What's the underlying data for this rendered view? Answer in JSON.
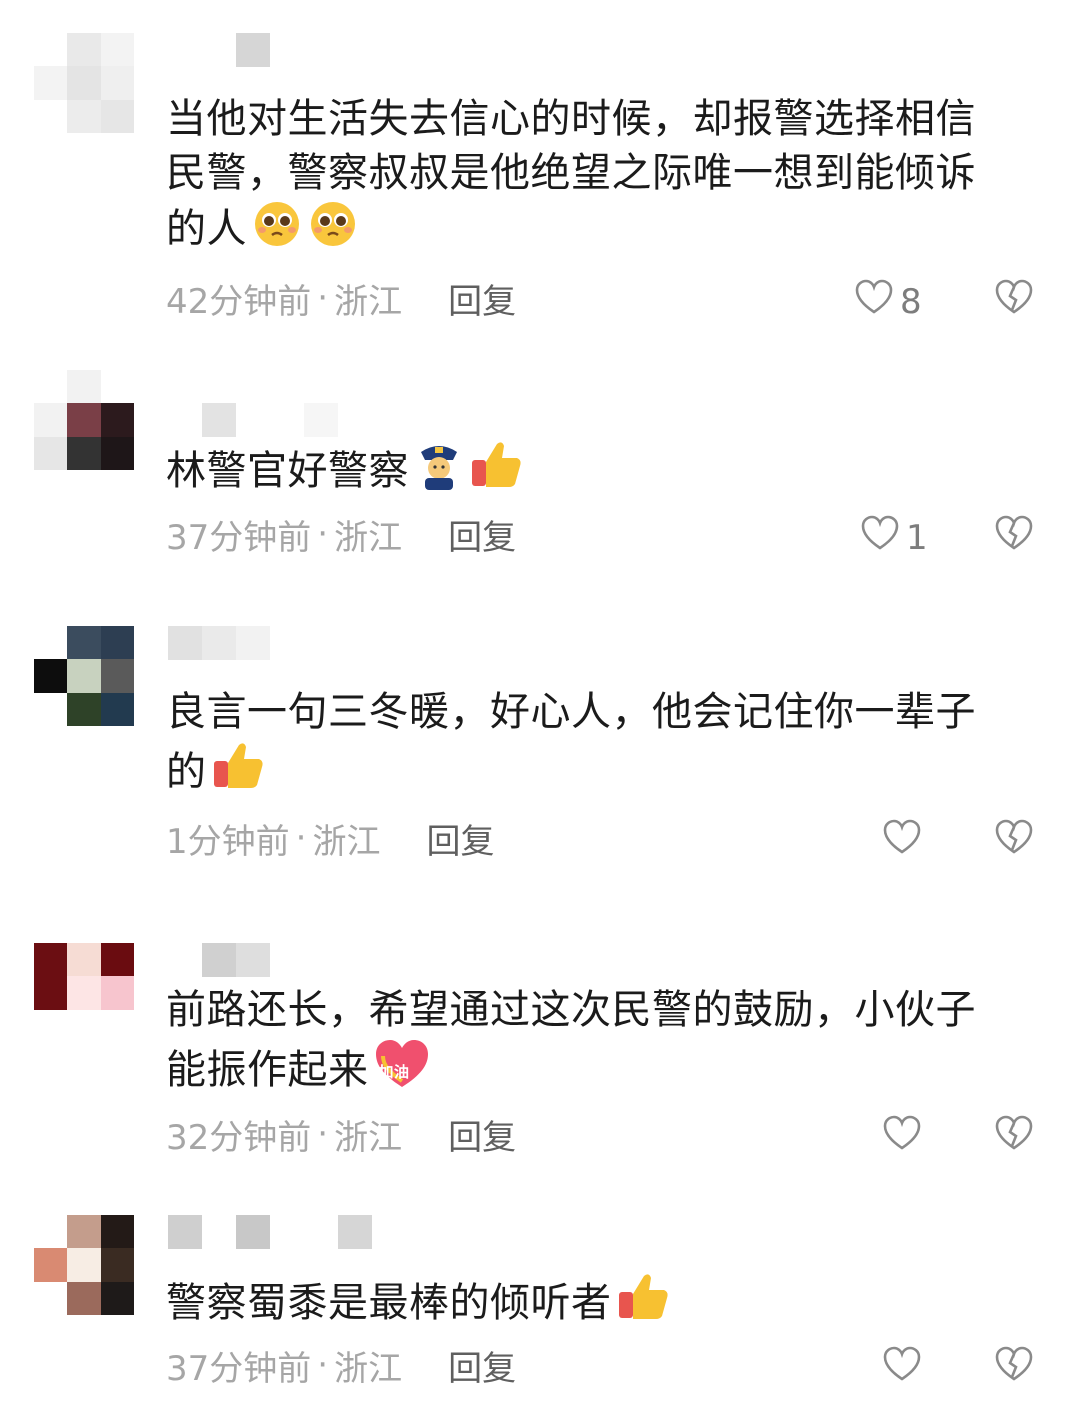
{
  "comments": [
    {
      "text": "当他对生活失去信心的时候，却报警选择相信民警，警察叔叔是他绝望之际唯一想到能倾诉的人",
      "emoji": [
        "pleading-face-emoji",
        "pleading-face-emoji"
      ],
      "time": "42分钟前",
      "location": "浙江",
      "reply": "回复",
      "likes": "8"
    },
    {
      "text": "林警官好警察",
      "emoji": [
        "police-officer-emoji",
        "thumbs-up-emoji"
      ],
      "time": "37分钟前",
      "location": "浙江",
      "reply": "回复",
      "likes": "1"
    },
    {
      "text": "良言一句三冬暖，好心人，他会记住你一辈子的",
      "emoji": [
        "thumbs-up-emoji"
      ],
      "time": "1分钟前",
      "location": "浙江",
      "reply": "回复",
      "likes": ""
    },
    {
      "text": "前路还长，希望通过这次民警的鼓励，小伙子能振作起来",
      "emoji": [
        "jiayou-heart-sticker"
      ],
      "emoji_text": "加油",
      "time": "32分钟前",
      "location": "浙江",
      "reply": "回复",
      "likes": ""
    },
    {
      "text": "警察蜀黍是最棒的倾听者",
      "emoji": [
        "thumbs-up-emoji"
      ],
      "time": "37分钟前",
      "location": "浙江",
      "reply": "回复",
      "likes": ""
    }
  ],
  "separator": "·",
  "colors": {
    "text": "#1b1b1b",
    "meta": "#a6a6a6",
    "reply": "#5f5f5f",
    "icon": "#8a8a8a"
  }
}
